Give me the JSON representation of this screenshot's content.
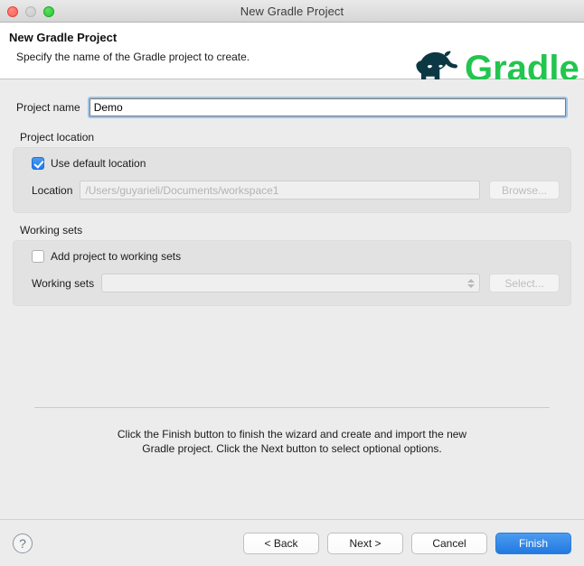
{
  "window": {
    "title": "New Gradle Project",
    "traffic_lights": [
      "close-button",
      "minimize-button",
      "zoom-button"
    ]
  },
  "header": {
    "title": "New Gradle Project",
    "subtitle": "Specify the name of the Gradle project to create.",
    "logo_text": "Gradle",
    "logo_green": "#22c54e",
    "logo_dark": "#0c3844"
  },
  "form": {
    "project_name": {
      "label": "Project name",
      "value": "Demo",
      "placeholder": "",
      "focused": true
    },
    "project_location": {
      "group_label": "Project location",
      "use_default_label": "Use default location",
      "use_default_checked": true,
      "location_label": "Location",
      "location_value": "/Users/guyarieli/Documents/workspace1",
      "location_disabled": true,
      "browse_label": "Browse...",
      "browse_disabled": true
    },
    "working_sets": {
      "group_label": "Working sets",
      "add_label": "Add project to working sets",
      "add_checked": false,
      "sets_label": "Working sets",
      "sets_value": "",
      "sets_disabled": true,
      "select_label": "Select...",
      "select_disabled": true
    }
  },
  "instructions": {
    "line1": "Click the Finish button to finish the wizard and create and import the new",
    "line2": "Gradle project. Click the Next button to select optional options."
  },
  "footer": {
    "help_label": "?",
    "back_label": "< Back",
    "next_label": "Next >",
    "cancel_label": "Cancel",
    "finish_label": "Finish",
    "finish_accent": "#2279e0"
  }
}
